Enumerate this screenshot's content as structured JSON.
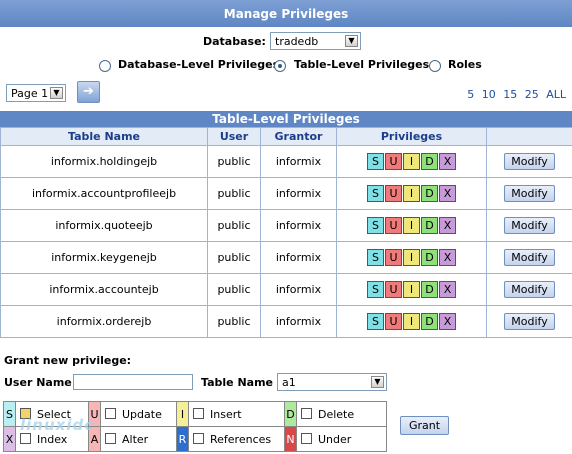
{
  "title": "Manage Privileges",
  "database": {
    "label": "Database:",
    "value": "tradedb"
  },
  "levels": [
    {
      "label": "Database-Level Privileges",
      "selected": false
    },
    {
      "label": "Table-Level Privileges",
      "selected": true
    },
    {
      "label": "Roles",
      "selected": false
    }
  ],
  "page_select": "Page 1",
  "pager": [
    "5",
    "10",
    "15",
    "25",
    "ALL"
  ],
  "grid": {
    "title": "Table-Level Privileges",
    "headers": [
      "Table Name",
      "User",
      "Grantor",
      "Privileges",
      ""
    ],
    "rows": [
      {
        "table": "informix.holdingejb",
        "user": "public",
        "grantor": "informix"
      },
      {
        "table": "informix.accountprofileejb",
        "user": "public",
        "grantor": "informix"
      },
      {
        "table": "informix.quoteejb",
        "user": "public",
        "grantor": "informix"
      },
      {
        "table": "informix.keygenejb",
        "user": "public",
        "grantor": "informix"
      },
      {
        "table": "informix.accountejb",
        "user": "public",
        "grantor": "informix"
      },
      {
        "table": "informix.orderejb",
        "user": "public",
        "grantor": "informix"
      }
    ],
    "priv_chips": [
      {
        "letter": "S",
        "color": "#7fe0e8"
      },
      {
        "letter": "U",
        "color": "#f07a7a"
      },
      {
        "letter": "I",
        "color": "#f0e77a"
      },
      {
        "letter": "D",
        "color": "#8fe07a"
      },
      {
        "letter": "X",
        "color": "#c79ad8"
      }
    ],
    "modify_label": "Modify"
  },
  "grant": {
    "title": "Grant new privilege:",
    "user_label": "User Name",
    "user_value": "",
    "table_label": "Table Name",
    "table_value": "a1",
    "options": [
      {
        "letter": "S",
        "color": "#b9eef2",
        "label": "Select"
      },
      {
        "letter": "U",
        "color": "#f6b6b6",
        "label": "Update"
      },
      {
        "letter": "I",
        "color": "#f5ef9a",
        "label": "Insert"
      },
      {
        "letter": "D",
        "color": "#aeea9c",
        "label": "Delete"
      },
      {
        "letter": "X",
        "color": "#dbbfe6",
        "label": "Index"
      },
      {
        "letter": "A",
        "color": "#f6b6b6",
        "label": "Alter"
      },
      {
        "letter": "R",
        "color": "#2d6fd0",
        "label": "References"
      },
      {
        "letter": "N",
        "color": "#d84848",
        "label": "Under"
      }
    ],
    "grant_label": "Grant"
  },
  "watermark": "linuxidc"
}
